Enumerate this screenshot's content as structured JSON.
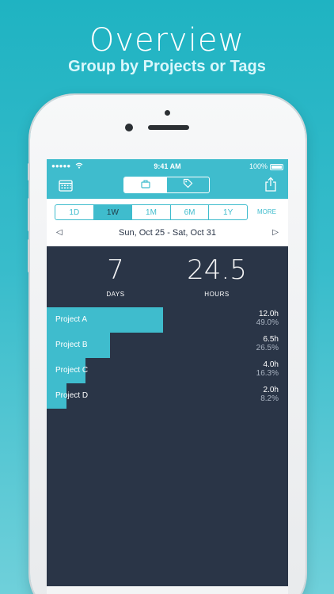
{
  "hero": {
    "title": "Overview",
    "subtitle": "Group by Projects or Tags"
  },
  "status_bar": {
    "signal": "●●●●●",
    "time": "9:41 AM",
    "battery": "100%"
  },
  "header": {
    "calendar_icon": "calendar-icon",
    "segments": [
      {
        "icon": "briefcase-icon",
        "active": true
      },
      {
        "icon": "tag-icon",
        "active": false
      }
    ],
    "share_icon": "share-icon"
  },
  "range_tabs": [
    {
      "label": "1D",
      "active": false
    },
    {
      "label": "1W",
      "active": true
    },
    {
      "label": "1M",
      "active": false
    },
    {
      "label": "6M",
      "active": false
    },
    {
      "label": "1Y",
      "active": false
    }
  ],
  "more_label": "MORE",
  "date_range": {
    "prev": "◁",
    "label": "Sun, Oct 25 - Sat, Oct 31",
    "next": "▷"
  },
  "summary": {
    "days_value": "7",
    "days_label": "DAYS",
    "hours_value": "24.5",
    "hours_label": "HOURS"
  },
  "projects": [
    {
      "name": "Project A",
      "hours": "12.0h",
      "percent": "49.0%",
      "fraction": 0.49
    },
    {
      "name": "Project B",
      "hours": "6.5h",
      "percent": "26.5%",
      "fraction": 0.265
    },
    {
      "name": "Project C",
      "hours": "4.0h",
      "percent": "16.3%",
      "fraction": 0.163
    },
    {
      "name": "Project D",
      "hours": "2.0h",
      "percent": "8.2%",
      "fraction": 0.082
    }
  ],
  "tab_bar": [
    {
      "icon": "list-icon",
      "active": false
    },
    {
      "icon": "overview-icon",
      "active": true
    },
    {
      "icon": "settings-gear-icon",
      "active": false
    }
  ],
  "colors": {
    "accent": "#3fbccd",
    "dark_bg": "#2a3547",
    "white": "#ffffff"
  }
}
